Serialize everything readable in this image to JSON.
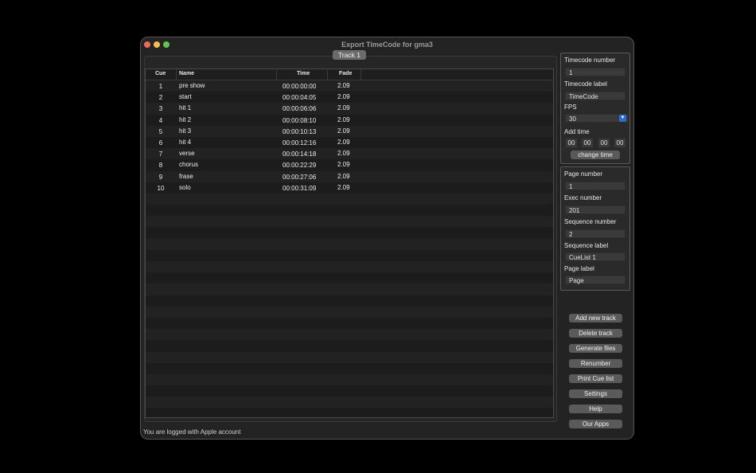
{
  "window": {
    "title": "Export TimeCode for gma3"
  },
  "tabs": [
    {
      "label": "Track 1"
    }
  ],
  "table": {
    "columns": [
      "Cue",
      "Name",
      "Time",
      "Fade"
    ],
    "rows": [
      {
        "cue": "1",
        "name": "pre show",
        "time": "00:00:00:00",
        "fade": "2.09"
      },
      {
        "cue": "2",
        "name": "start",
        "time": "00:00:04:05",
        "fade": "2.09"
      },
      {
        "cue": "3",
        "name": "hit 1",
        "time": "00:00:06:06",
        "fade": "2.09"
      },
      {
        "cue": "4",
        "name": "hit 2",
        "time": "00:00:08:10",
        "fade": "2.09"
      },
      {
        "cue": "5",
        "name": "hit 3",
        "time": "00:00:10:13",
        "fade": "2.09"
      },
      {
        "cue": "6",
        "name": "hit 4",
        "time": "00:00:12:16",
        "fade": "2.09"
      },
      {
        "cue": "7",
        "name": "verse",
        "time": "00:00:14:18",
        "fade": "2.09"
      },
      {
        "cue": "8",
        "name": "chorus",
        "time": "00:00:22:29",
        "fade": "2.09"
      },
      {
        "cue": "9",
        "name": "frase",
        "time": "00:00:27:06",
        "fade": "2.09"
      },
      {
        "cue": "10",
        "name": "solo",
        "time": "00:00:31:09",
        "fade": "2.09"
      }
    ]
  },
  "timecode": {
    "number_label": "Timecode number",
    "number_value": "1",
    "label_label": "Timecode label",
    "label_value": "TimeCode",
    "fps_label": "FPS",
    "fps_value": "30",
    "add_time_label": "Add time",
    "add_time": [
      "00",
      "00",
      "00",
      "00"
    ],
    "change_time_button": "change time"
  },
  "sequence": {
    "page_number_label": "Page number",
    "page_number_value": "1",
    "exec_number_label": "Exec number",
    "exec_number_value": "201",
    "sequence_number_label": "Sequence number",
    "sequence_number_value": "2",
    "sequence_label_label": "Sequence label",
    "sequence_label_value": "CueList 1",
    "page_label_label": "Page label",
    "page_label_value": "Page"
  },
  "actions": {
    "add_track": "Add new track",
    "delete_track": "Delete track",
    "generate_files": "Generate files",
    "renumber": "Renumber",
    "print_cue_list": "Print Cue list",
    "settings": "Settings",
    "help": "Help",
    "our_apps": "Our Apps"
  },
  "status": {
    "text": "You are logged with Apple account"
  },
  "colors": {
    "accent": "#2f6bd6",
    "background": "#232323"
  }
}
